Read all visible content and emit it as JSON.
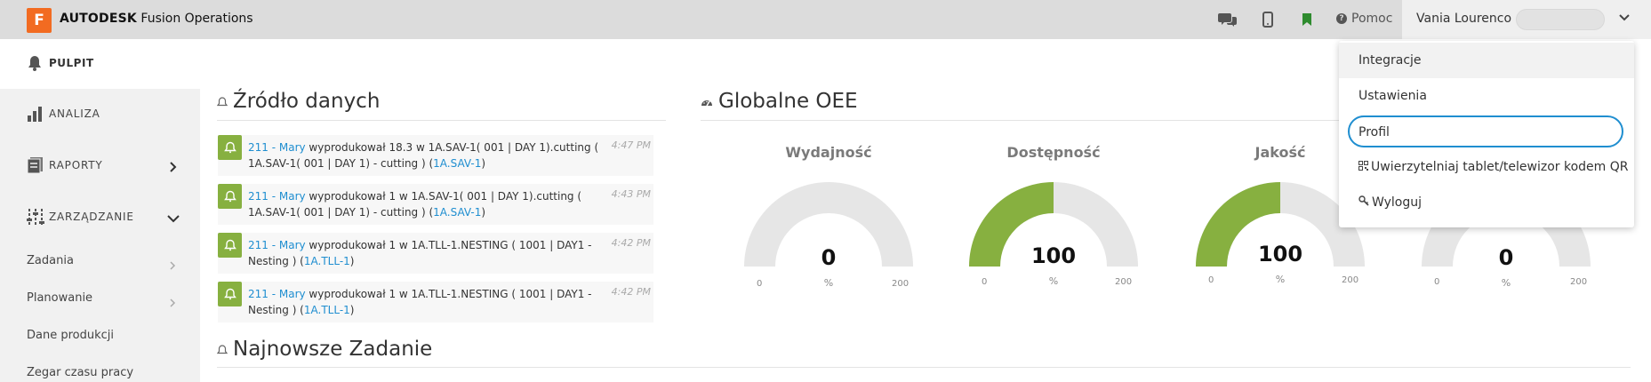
{
  "header": {
    "logo_letter": "F",
    "brand_bold": "AUTODESK",
    "brand_rest": " Fusion Operations",
    "icons": [
      "chat-icon",
      "mobile-icon",
      "bookmark-icon"
    ],
    "help_label": "Pomoc",
    "user_name": "Vania Lourenco"
  },
  "sidebar": {
    "pulpit": "PULPIT",
    "items": [
      {
        "label": "ANALIZA",
        "icon": "bar-chart-icon"
      },
      {
        "label": "RAPORTY",
        "icon": "reports-icon"
      },
      {
        "label": "ZARZĄDZANIE",
        "icon": "sliders-icon"
      }
    ],
    "subitems": [
      {
        "label": "Zadania"
      },
      {
        "label": "Planowanie"
      },
      {
        "label": "Dane produkcji"
      },
      {
        "label": "Zegar czasu pracy"
      }
    ]
  },
  "sections": {
    "source": "Źródło danych",
    "oee": "Globalne OEE",
    "latest": "Najnowsze Zadanie"
  },
  "feed": [
    {
      "user": "211 - Mary",
      "text": " wyprodukował 18.3 w 1A.SAV-1( 001 | DAY 1).cutting ( 1A.SAV-1( 001 | DAY 1) - cutting ) (",
      "link": "1A.SAV-1",
      "tail": ")",
      "time": "4:47 PM"
    },
    {
      "user": "211 - Mary",
      "text": " wyprodukował 1 w 1A.SAV-1( 001 | DAY 1).cutting ( 1A.SAV-1( 001 | DAY 1) - cutting ) (",
      "link": "1A.SAV-1",
      "tail": ")",
      "time": "4:43 PM"
    },
    {
      "user": "211 - Mary",
      "text": " wyprodukował 1 w 1A.TLL-1.NESTING ( 1001 | DAY1 - Nesting ) (",
      "link": "1A.TLL-1",
      "tail": ")",
      "time": "4:42 PM"
    },
    {
      "user": "211 - Mary",
      "text": " wyprodukował 1 w 1A.TLL-1.NESTING ( 1001 | DAY1 - Nesting ) (",
      "link": "1A.TLL-1",
      "tail": ")",
      "time": "4:42 PM"
    }
  ],
  "gauges": [
    {
      "title": "Wydajność",
      "value": 0,
      "display": "0",
      "unit": "%",
      "min": "0",
      "max": "200"
    },
    {
      "title": "Dostępność",
      "value": 100,
      "display": "100",
      "unit": "%",
      "min": "0",
      "max": "200"
    },
    {
      "title": "Jakość",
      "value": 100,
      "display": "100",
      "unit": "%",
      "min": "0",
      "max": "200"
    },
    {
      "title": "",
      "value": 0,
      "display": "0",
      "unit": "%",
      "min": "0",
      "max": "200"
    }
  ],
  "dropdown": {
    "items": [
      {
        "label": "Integracje"
      },
      {
        "label": "Ustawienia"
      },
      {
        "label": "Profil"
      },
      {
        "label": "Uwierzytelniaj tablet/telewizor kodem QR",
        "icon": "qr-icon"
      },
      {
        "label": "Wyloguj",
        "icon": "key-icon"
      }
    ]
  },
  "colors": {
    "accent_green": "#87b040",
    "link_blue": "#1f8ed0",
    "brand_orange": "#f26b21",
    "gauge_track": "#e6e6e6"
  }
}
